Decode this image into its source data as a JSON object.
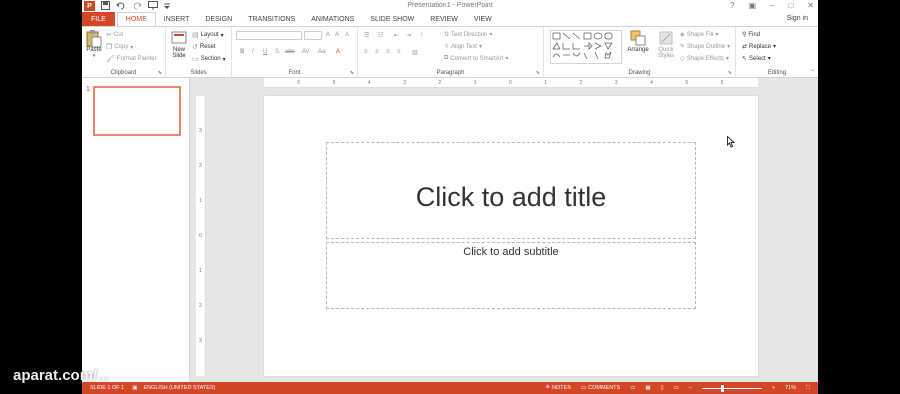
{
  "app": {
    "window_title": "Presentation1 - PowerPoint",
    "sign_in": "Sign in",
    "brand_color": "#d24726"
  },
  "qat": {
    "app_icon": "powerpoint-icon",
    "icons": [
      "save-icon",
      "undo-icon",
      "redo-icon",
      "present-icon",
      "customize-icon"
    ]
  },
  "window_controls": {
    "help": "?",
    "restore": "▣",
    "minimize": "–",
    "maximize": "□",
    "close": "✕"
  },
  "tabs": [
    {
      "label": "FILE",
      "kind": "file"
    },
    {
      "label": "HOME",
      "kind": "active"
    },
    {
      "label": "INSERT",
      "kind": ""
    },
    {
      "label": "DESIGN",
      "kind": ""
    },
    {
      "label": "TRANSITIONS",
      "kind": ""
    },
    {
      "label": "ANIMATIONS",
      "kind": ""
    },
    {
      "label": "SLIDE SHOW",
      "kind": ""
    },
    {
      "label": "REVIEW",
      "kind": ""
    },
    {
      "label": "VIEW",
      "kind": ""
    }
  ],
  "ribbon": {
    "clipboard": {
      "label": "Clipboard",
      "paste": "Paste",
      "cut": "Cut",
      "copy": "Copy",
      "format_painter": "Format Painter"
    },
    "slides": {
      "label": "Slides",
      "new_slide_line1": "New",
      "new_slide_line2": "Slide",
      "layout": "Layout",
      "reset": "Reset",
      "section": "Section"
    },
    "font": {
      "label": "Font",
      "bold": "B",
      "italic": "I",
      "underline": "U",
      "strikethrough": "S",
      "shadow": "abc",
      "spacing": "AV",
      "case": "Aa",
      "grow": "A",
      "shrink": "A",
      "clear": "A",
      "color": "A"
    },
    "paragraph": {
      "label": "Paragraph",
      "text_direction": "Text Direction",
      "align_text": "Align Text",
      "convert_smartart": "Convert to SmartArt"
    },
    "drawing": {
      "label": "Drawing",
      "arrange": "Arrange",
      "quick_styles_line1": "Quick",
      "quick_styles_line2": "Styles",
      "shape_fill": "Shape Fill",
      "shape_outline": "Shape Outline",
      "shape_effects": "Shape Effects"
    },
    "editing": {
      "label": "Editing",
      "find": "Find",
      "replace": "Replace",
      "select": "Select"
    }
  },
  "thumbnails": [
    {
      "number": "1"
    }
  ],
  "ruler": {
    "horizontal": [
      "6",
      "5",
      "4",
      "3",
      "2",
      "1",
      "0",
      "1",
      "2",
      "3",
      "4",
      "5",
      "6"
    ],
    "vertical": [
      "3",
      "2",
      "1",
      "0",
      "1",
      "2",
      "3"
    ]
  },
  "slide": {
    "title_placeholder": "Click to add title",
    "subtitle_placeholder": "Click to add subtitle"
  },
  "status_bar": {
    "slide_info": "SLIDE 1 OF 1",
    "language": "ENGLISH (UNITED STATES)",
    "notes": "NOTES",
    "comments": "COMMENTS",
    "zoom": "71%",
    "zoom_fraction": 0.71
  },
  "watermark": {
    "text": "aparat.com/..."
  }
}
